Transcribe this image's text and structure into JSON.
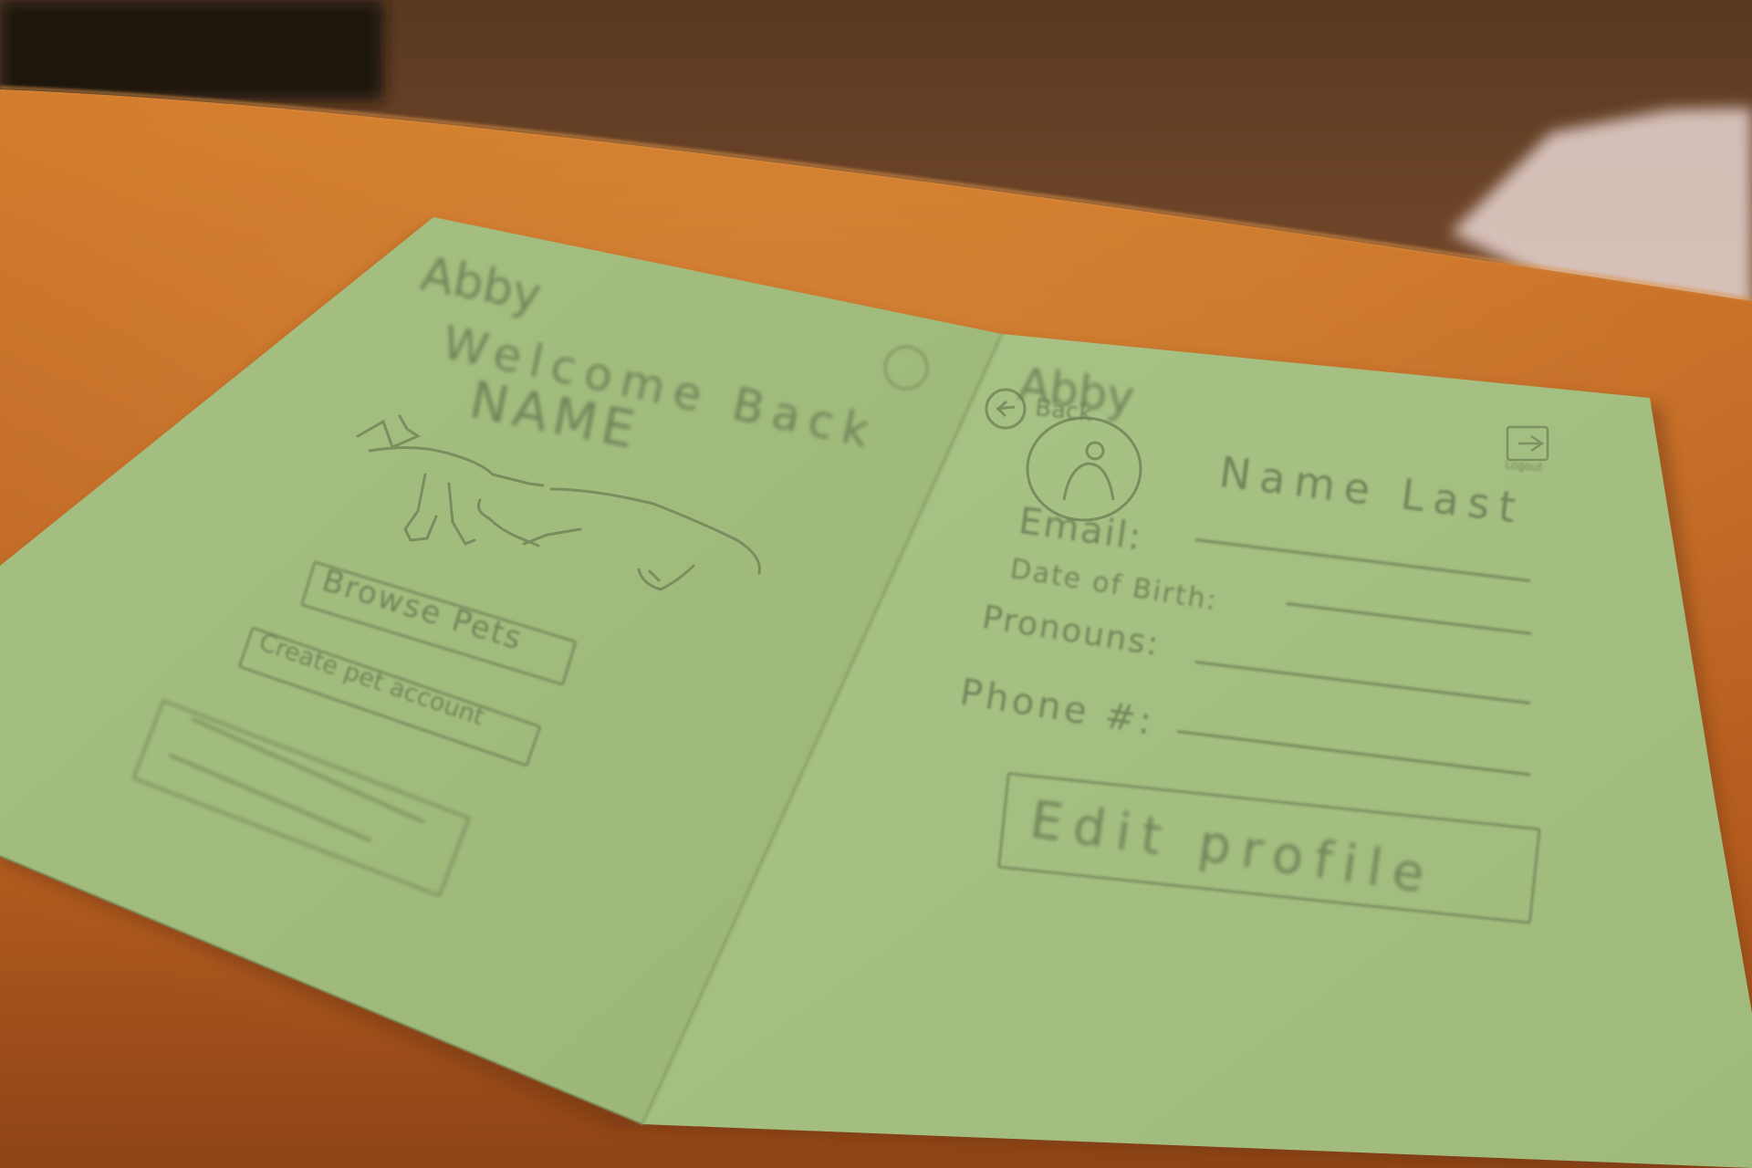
{
  "colors": {
    "table": "#c77530",
    "table_dark": "#8a4316",
    "paper": "#a2bc7f",
    "pencil": "#6e7d55",
    "wall": "#70462a"
  },
  "left_page": {
    "app_name": "Abby",
    "welcome": "Welcome Back",
    "name": "NAME",
    "avatar_icon": "avatar-circle-icon",
    "illustration_icon": "animals-sketch-icon",
    "buttons": [
      "Browse Pets",
      "Create pet account"
    ]
  },
  "right_page": {
    "app_name": "Abby",
    "back_label": "Back",
    "back_icon": "back-arrow-icon",
    "logout_label": "Logout",
    "logout_icon": "logout-icon",
    "profile_icon": "profile-avatar-icon",
    "full_name": "Name Last",
    "fields": [
      {
        "label": "Email:"
      },
      {
        "label": "Date of Birth:"
      },
      {
        "label": "Pronouns:"
      },
      {
        "label": "Phone #:"
      }
    ],
    "edit_button": "Edit profile"
  }
}
